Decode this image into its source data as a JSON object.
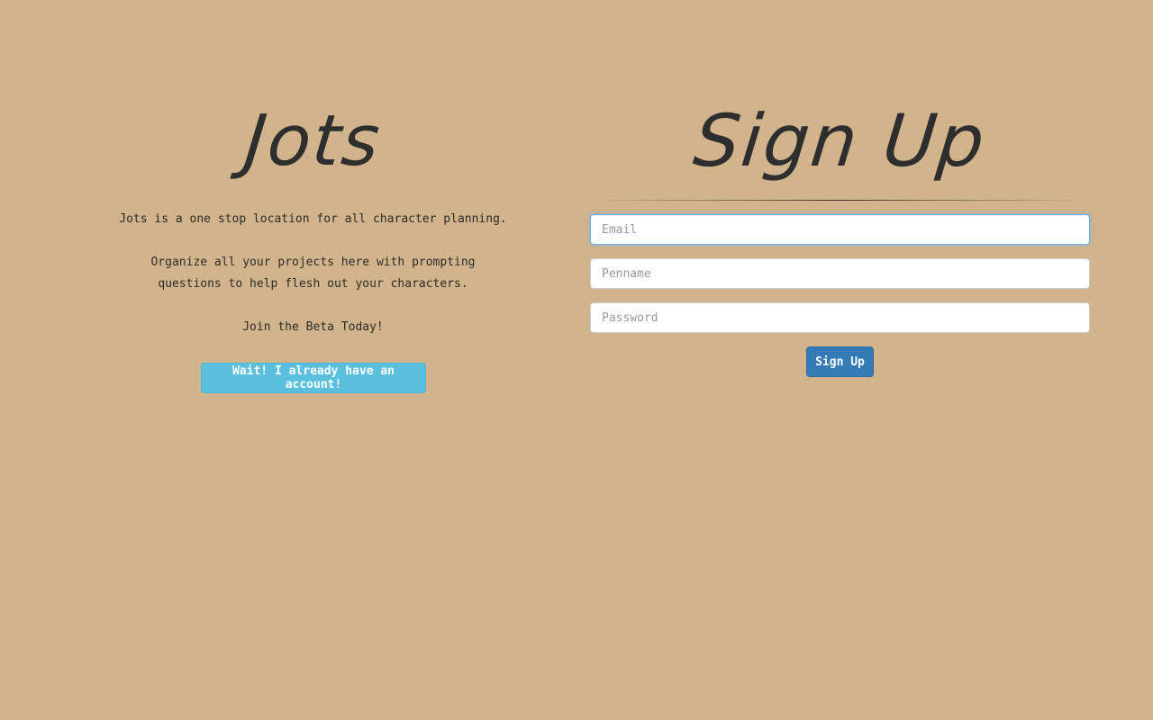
{
  "intro": {
    "title": "Jots",
    "description_1": "Jots is a one stop location for all character planning.",
    "description_2": "Organize all your projects here with prompting questions to help flesh out your characters.",
    "description_3": "Join the Beta Today!",
    "login_button_label": "Wait! I already have an account!"
  },
  "signup": {
    "title": "Sign Up",
    "email_placeholder": "Email",
    "email_value": "",
    "penname_placeholder": "Penname",
    "penname_value": "",
    "password_placeholder": "Password",
    "password_value": "",
    "submit_label": "Sign Up"
  },
  "colors": {
    "background": "#d2b48c",
    "info_button": "#5bc0de",
    "primary_button": "#337ab7",
    "text": "#2b2b2b"
  }
}
